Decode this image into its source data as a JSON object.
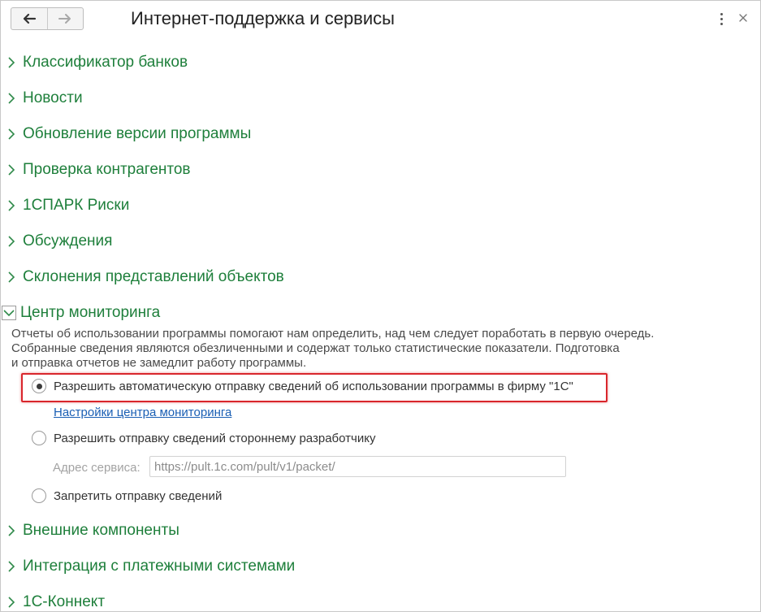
{
  "window": {
    "title": "Интернет-поддержка и сервисы",
    "nav": {
      "back_icon": "arrow-left-icon",
      "forward_icon": "arrow-right-icon"
    },
    "menu_icon": "more-vertical-icon",
    "close_icon": "close-icon"
  },
  "colors": {
    "section_label": "#1e7f3b",
    "link": "#1a5fb4",
    "highlight": "#d9262c"
  },
  "sections_before": [
    {
      "label": "Классификатор банков"
    },
    {
      "label": "Новости"
    },
    {
      "label": "Обновление версии программы"
    },
    {
      "label": "Проверка контрагентов"
    },
    {
      "label": "1СПАРК Риски"
    },
    {
      "label": "Обсуждения"
    },
    {
      "label": "Склонения представлений объектов"
    }
  ],
  "monitoring": {
    "label": "Центр мониторинга",
    "description": [
      "Отчеты об использовании программы помогают нам определить, над чем следует поработать в первую очередь.",
      "Собранные сведения являются обезличенными и содержат только статистические показатели. Подготовка",
      "и отправка отчетов не замедлит работу программы."
    ],
    "options": [
      {
        "label": "Разрешить автоматическую отправку сведений об использовании программы в фирму \"1С\"",
        "checked": true
      },
      {
        "label": "Разрешить отправку сведений стороннему разработчику",
        "checked": false
      },
      {
        "label": "Запретить отправку сведений",
        "checked": false
      }
    ],
    "settings_link": "Настройки центра мониторинга",
    "service_address_label": "Адрес сервиса:",
    "service_address_value": "https://pult.1c.com/pult/v1/packet/"
  },
  "sections_after": [
    {
      "label": "Внешние компоненты"
    },
    {
      "label": "Интеграция с платежными системами"
    },
    {
      "label": "1С-Коннект"
    }
  ]
}
